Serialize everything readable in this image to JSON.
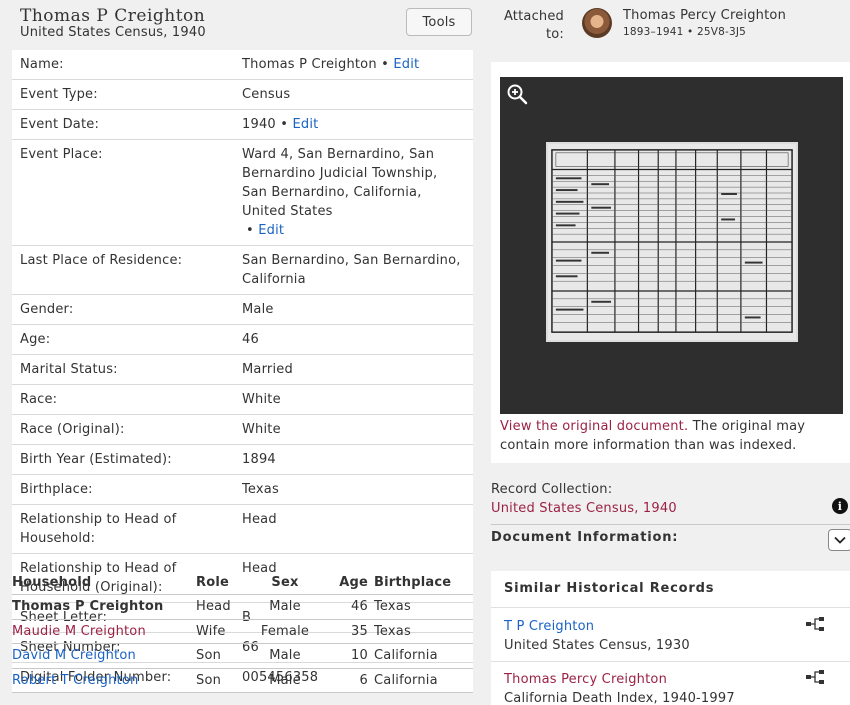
{
  "header": {
    "title": "Thomas P Creighton",
    "subtitle": "United States Census, 1940",
    "tools_label": "Tools"
  },
  "facts": [
    {
      "label": "Name:",
      "value": "Thomas P Creighton",
      "edit": "Edit"
    },
    {
      "label": "Event Type:",
      "value": "Census"
    },
    {
      "label": "Event Date:",
      "value": "1940",
      "edit": "Edit"
    },
    {
      "label": "Event Place:",
      "value": "Ward 4, San Bernardino, San Bernardino Judicial Township, San Bernardino, California, United States",
      "edit": "Edit"
    },
    {
      "label": "Last Place of Residence:",
      "value": "San Bernardino, San Bernardino, California"
    },
    {
      "label": "Gender:",
      "value": "Male"
    },
    {
      "label": "Age:",
      "value": "46"
    },
    {
      "label": "Marital Status:",
      "value": "Married"
    },
    {
      "label": "Race:",
      "value": "White"
    },
    {
      "label": "Race (Original):",
      "value": "White"
    },
    {
      "label": "Birth Year (Estimated):",
      "value": "1894"
    },
    {
      "label": "Birthplace:",
      "value": "Texas"
    },
    {
      "label": "Relationship to Head of Household:",
      "value": "Head"
    },
    {
      "label": "Relationship to Head of Household (Original):",
      "value": "Head"
    },
    {
      "label": "Sheet Letter:",
      "value": "B"
    },
    {
      "label": "Sheet Number:",
      "value": "66"
    },
    {
      "label": "Digital Folder Number:",
      "value": "005456358"
    }
  ],
  "household": {
    "headers": {
      "name": "Household",
      "role": "Role",
      "sex": "Sex",
      "age": "Age",
      "birthplace": "Birthplace"
    },
    "members": [
      {
        "name": "Thomas P Creighton",
        "role": "Head",
        "sex": "Male",
        "age": "46",
        "birthplace": "Texas"
      },
      {
        "name": "Maudie M Creighton",
        "role": "Wife",
        "sex": "Female",
        "age": "35",
        "birthplace": "Texas"
      },
      {
        "name": "David M Creighton",
        "role": "Son",
        "sex": "Male",
        "age": "10",
        "birthplace": "California"
      },
      {
        "name": "Robert T Creighton",
        "role": "Son",
        "sex": "Male",
        "age": "6",
        "birthplace": "California"
      }
    ]
  },
  "attached": {
    "label": "Attached to:",
    "person_name": "Thomas Percy Creighton",
    "person_dates": "1893–1941 • 25V8-3J5"
  },
  "image": {
    "link_text": "View the original document.",
    "caption_rest": " The original may contain more information than was indexed."
  },
  "record_collection": {
    "label": "Record Collection:",
    "value": "United States Census, 1940"
  },
  "document_info": {
    "label": "Document Information:"
  },
  "similar": {
    "heading": "Similar Historical Records",
    "items": [
      {
        "name": "T P Creighton",
        "collection": "United States Census, 1930"
      },
      {
        "name": "Thomas Percy Creighton",
        "collection": "California Death Index, 1940-1997"
      }
    ]
  },
  "colors": {
    "link": "#1a63c4",
    "maroon_link": "#9b2245",
    "background": "#f0f0f0",
    "image_bg": "#2e2e2e"
  },
  "icons": [
    "zoom-in-icon",
    "info-icon",
    "chevron-down-icon",
    "tree-icon"
  ]
}
